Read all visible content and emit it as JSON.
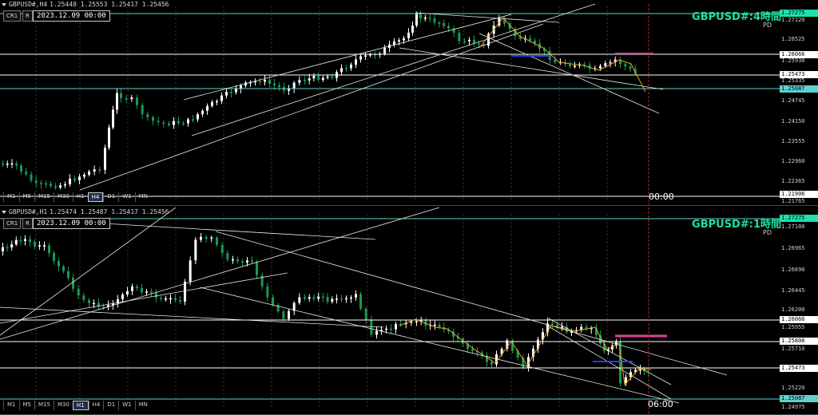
{
  "top": {
    "symbol": "GBPUSD#,H4",
    "ohlc": "1.25448 1.25553 1.25417 1.25456",
    "time_box": "2023.12.09 00:00",
    "label": "GBPUSD#:4時間",
    "pd": "PD",
    "btn_cr": "CR1",
    "btn_r": "R",
    "timeframes": [
      "M1",
      "M5",
      "M15",
      "M30",
      "H1",
      "H4",
      "D1",
      "W1",
      "MN"
    ],
    "active_tf": "H4",
    "time_mark": "00:00",
    "price_labels": [
      {
        "text": "1.27275",
        "style": "hl"
      },
      {
        "text": "1.27120",
        "style": "plain"
      },
      {
        "text": "1.26525",
        "style": "plain"
      },
      {
        "text": "1.26066",
        "style": "white"
      },
      {
        "text": "1.25930",
        "style": "plain"
      },
      {
        "text": "1.25473",
        "style": "white"
      },
      {
        "text": "1.25335",
        "style": "plain"
      },
      {
        "text": "1.25087",
        "style": "cyan"
      },
      {
        "text": "1.24745",
        "style": "plain"
      },
      {
        "text": "1.24150",
        "style": "plain"
      },
      {
        "text": "1.23555",
        "style": "plain"
      },
      {
        "text": "1.22960",
        "style": "plain"
      },
      {
        "text": "1.22365",
        "style": "plain"
      },
      {
        "text": "1.21906",
        "style": "white"
      },
      {
        "text": "1.21765",
        "style": "plain"
      }
    ]
  },
  "bottom": {
    "symbol": "GBPUSD#,H1",
    "ohlc": "1.25474 1.25487 1.25417 1.25456",
    "time_box": "2023.12.09 00:00",
    "label": "GBPUSD#:1時間",
    "pd": "PD",
    "btn_cr": "CR1",
    "btn_r": "R",
    "timeframes": [
      "M1",
      "M5",
      "M15",
      "M30",
      "H1",
      "H4",
      "D1",
      "W1",
      "MN"
    ],
    "active_tf": "H1",
    "time_mark": "06:00",
    "price_labels": [
      {
        "text": "1.27275",
        "style": "hl"
      },
      {
        "text": "1.27180",
        "style": "plain"
      },
      {
        "text": "1.26965",
        "style": "plain"
      },
      {
        "text": "1.26690",
        "style": "plain"
      },
      {
        "text": "1.26445",
        "style": "plain"
      },
      {
        "text": "1.26200",
        "style": "plain"
      },
      {
        "text": "1.26066",
        "style": "white"
      },
      {
        "text": "1.25955",
        "style": "plain"
      },
      {
        "text": "1.25808",
        "style": "white"
      },
      {
        "text": "1.25710",
        "style": "plain"
      },
      {
        "text": "1.25473",
        "style": "white"
      },
      {
        "text": "1.25220",
        "style": "plain"
      },
      {
        "text": "1.25087",
        "style": "cyan"
      },
      {
        "text": "1.24975",
        "style": "plain"
      }
    ]
  },
  "colors": {
    "candle_up": "#ffffff",
    "candle_down": "#1a9a50",
    "background": "#000000",
    "cyan_line": "#5fd0d0",
    "magenta_zone": "#e0409a",
    "blue_zone": "#2040ff",
    "zigzag": "#e8a020",
    "vline": "#d02020"
  }
}
